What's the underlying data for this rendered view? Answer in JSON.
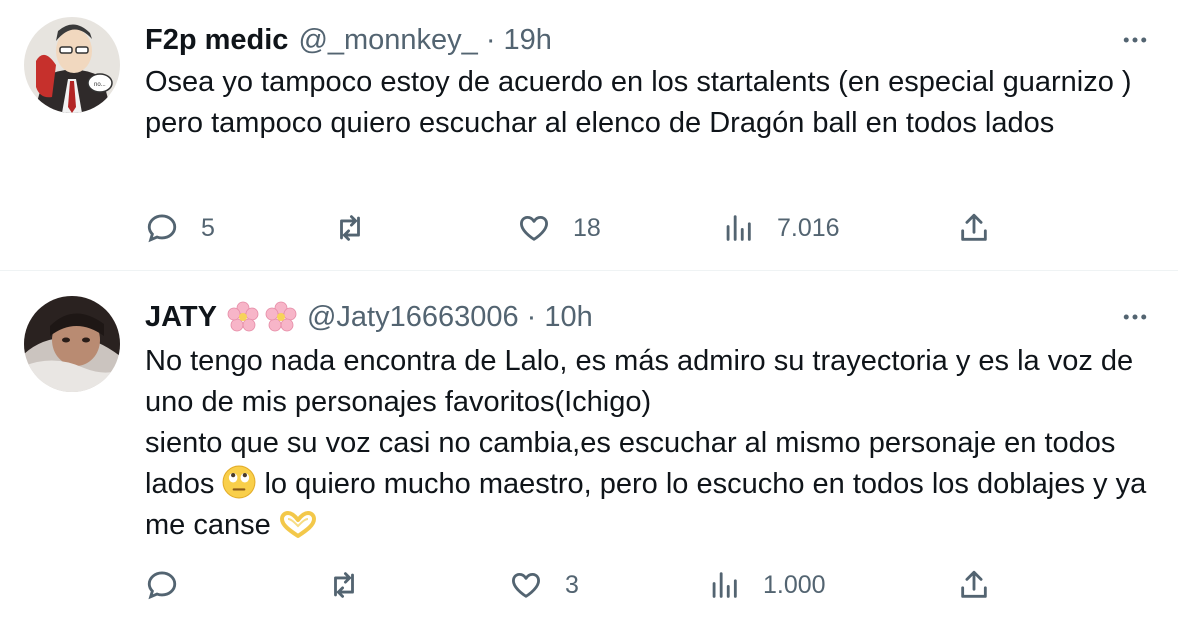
{
  "colors": {
    "text": "#0f1419",
    "secondary": "#536471",
    "divider": "#eff3f4"
  },
  "more_icon": "more-horizontal-icon",
  "tweets": [
    {
      "name": "F2p medic",
      "handle": "@_monnkey_",
      "separator": "·",
      "time": "19h",
      "text_lines": [
        "Osea yo tampoco estoy de acuerdo en los startalents (en especial guarnizo ) pero tampoco quiero escuchar al elenco de Dragón ball en todos lados"
      ],
      "stats": {
        "replies": "5",
        "retweets": "",
        "likes": "18",
        "views": "7.016"
      }
    },
    {
      "name": "JATY",
      "name_emoji": "cherry-blossom x2",
      "handle": "@Jaty16663006",
      "separator": "·",
      "time": "10h",
      "text_lines": [
        "No tengo nada encontra de Lalo, es más admiro su trayectoria y es la voz de uno de mis personajes favoritos(Ichigo)",
        "siento que su voz casi no cambia,es escuchar al mismo personaje en todos lados",
        "lo quiero mucho maestro, pero lo escucho en todos los doblajes y ya me canse"
      ],
      "stats": {
        "replies": "",
        "retweets": "",
        "likes": "3",
        "views": "1.000"
      }
    }
  ]
}
